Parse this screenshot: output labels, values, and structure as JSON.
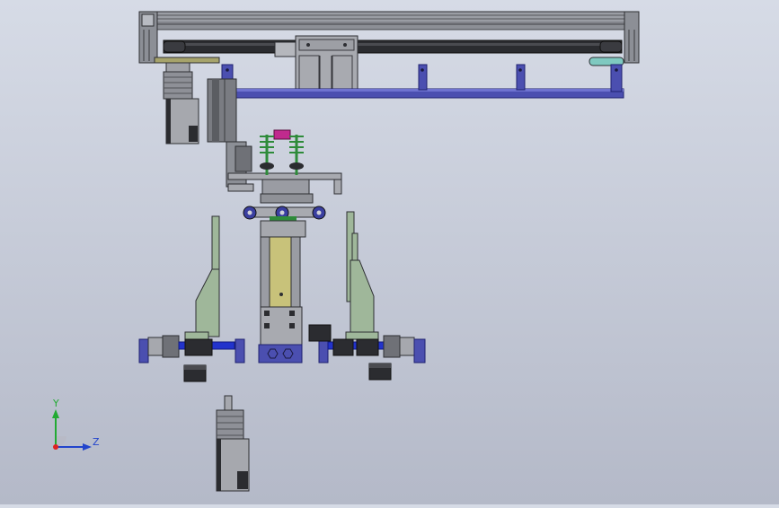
{
  "colors": {
    "background_top": "#d6dbe6",
    "background_bottom": "#b4b9c8",
    "frame_grey": "#8c8f96",
    "frame_dark": "#2e2f33",
    "rail_blue": "#4b4fb0",
    "guide_green": "#9fb79a",
    "motor_grey": "#9a9ca3",
    "rod_blue": "#2233cc",
    "cylinder_olive": "#c8c27a",
    "spring_green": "#2e8b3a",
    "magenta": "#c02a8e",
    "teal": "#7fc9c0"
  },
  "triad": {
    "y_label": "Y",
    "z_label": "Z"
  }
}
